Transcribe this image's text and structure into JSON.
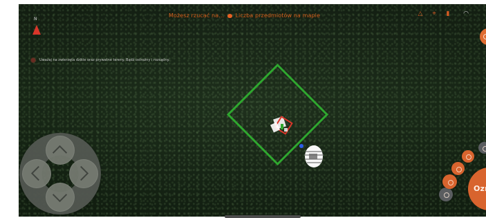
{
  "game": {
    "top_message": {
      "before_icon": "Możesz rzucać na...",
      "icon_name": "heart-icon",
      "after_icon": " Liczba przedmiotów na mapie"
    },
    "compass": {
      "label": "N",
      "icon_name": "north-arrow-icon"
    },
    "status_bar": {
      "icons": [
        "alert-icon",
        "pin-icon",
        "signal-icon",
        "wifi-icon"
      ]
    },
    "warning": {
      "text": "Uważaj na zwierzęta dzikie oraz prywatne tereny. Bądź ostrożny i rozsądny."
    },
    "controls": {
      "mark_button_label": "Oznacz",
      "small_button_icons": [
        "settings-icon",
        "filter-icon",
        "map-icon",
        "check-icon",
        "bag-icon",
        "menu-icon"
      ]
    },
    "colors": {
      "accent": "#d8642e",
      "target": "#2fa72f",
      "warning": "#d9362a"
    }
  }
}
